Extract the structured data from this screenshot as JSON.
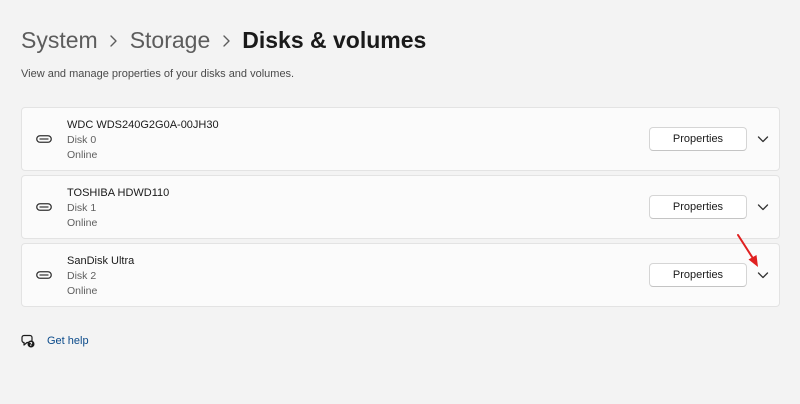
{
  "breadcrumb": {
    "items": [
      "System",
      "Storage",
      "Disks & volumes"
    ]
  },
  "subtitle": "View and manage properties of your disks and volumes.",
  "disks": [
    {
      "name": "WDC WDS240G2G0A-00JH30",
      "disk": "Disk 0",
      "status": "Online",
      "button_label": "Properties"
    },
    {
      "name": "TOSHIBA HDWD110",
      "disk": "Disk 1",
      "status": "Online",
      "button_label": "Properties"
    },
    {
      "name": "SanDisk Ultra",
      "disk": "Disk 2",
      "status": "Online",
      "button_label": "Properties"
    }
  ],
  "help": {
    "label": "Get help"
  },
  "icons": {
    "disk": "hard-drive-icon",
    "expand": "chevron-down-icon",
    "separator": "chevron-right-icon",
    "help": "help-chat-icon",
    "annotation": "red-arrow-icon"
  },
  "colors": {
    "background": "#f3f3f3",
    "card": "#fbfbfb",
    "link": "#0a4a8a",
    "annotation": "#e02020"
  }
}
